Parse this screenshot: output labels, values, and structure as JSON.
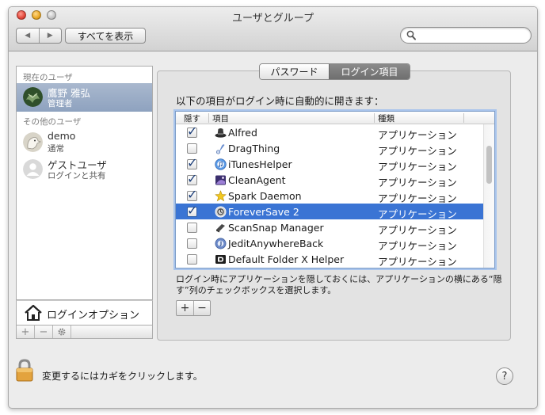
{
  "window": {
    "title": "ユーザとグループ"
  },
  "toolbar": {
    "back": "◀",
    "forward": "▶",
    "show_all": "すべてを表示",
    "search_value": "",
    "search_placeholder": ""
  },
  "sidebar": {
    "current_header": "現在のユーザ",
    "current_user": {
      "name": "鷹野 雅弘",
      "role": "管理者"
    },
    "other_header": "その他のユーザ",
    "others": [
      {
        "name": "demo",
        "role": "通常"
      },
      {
        "name": "ゲストユーザ",
        "role": "ログインと共有"
      }
    ],
    "login_options": "ログインオプション",
    "bar": {
      "add": "+",
      "remove": "−"
    }
  },
  "tabs": {
    "password": "パスワード",
    "login_items": "ログイン項目",
    "active": "login_items"
  },
  "login_items": {
    "description": "以下の項目がログイン時に自動的に開きます：",
    "col_hide": "隠す",
    "col_item": "項目",
    "col_kind": "種類",
    "rows": [
      {
        "hide": true,
        "name": "Alfred",
        "kind": "アプリケーション",
        "icon": "alfred-hat-icon"
      },
      {
        "hide": false,
        "name": "DragThing",
        "kind": "アプリケーション",
        "icon": "dragthing-icon"
      },
      {
        "hide": true,
        "name": "iTunesHelper",
        "kind": "アプリケーション",
        "icon": "itunes-icon"
      },
      {
        "hide": true,
        "name": "CleanAgent",
        "kind": "アプリケーション",
        "icon": "cleanagent-icon"
      },
      {
        "hide": true,
        "name": "Spark Daemon",
        "kind": "アプリケーション",
        "icon": "spark-star-icon"
      },
      {
        "hide": true,
        "name": "ForeverSave 2",
        "kind": "アプリケーション",
        "icon": "foreversave-icon",
        "selected": true
      },
      {
        "hide": false,
        "name": "ScanSnap Manager",
        "kind": "アプリケーション",
        "icon": "scansnap-icon"
      },
      {
        "hide": false,
        "name": "JeditAnywhereBack",
        "kind": "アプリケーション",
        "icon": "jedit-icon"
      },
      {
        "hide": false,
        "name": "Default Folder X Helper",
        "kind": "アプリケーション",
        "icon": "defaultfolder-icon"
      }
    ],
    "hint": "ログイン時にアプリケーションを隠しておくには、アプリケーションの横にある“隠す”列のチェックボックスを選択します。",
    "add": "+",
    "remove": "−"
  },
  "footer": {
    "lock_text": "変更するにはカギをクリックします。",
    "help": "?"
  },
  "colors": {
    "selection": "#3a74d4",
    "sidebar_selection": "#8ea2bf"
  }
}
